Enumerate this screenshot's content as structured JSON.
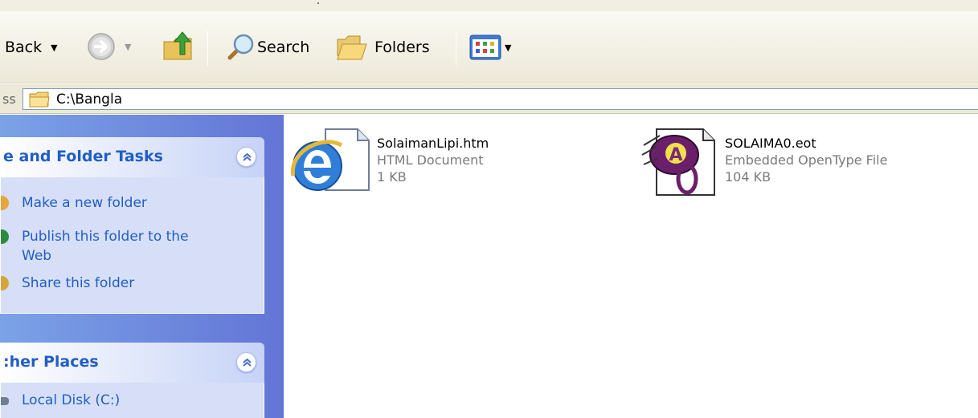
{
  "toolbar": {
    "back_label": "Back",
    "search_label": "Search",
    "folders_label": "Folders"
  },
  "address": {
    "label": "ss",
    "path": "C:\\Bangla"
  },
  "taskpane": {
    "file_tasks": {
      "title": "e and Folder Tasks",
      "items": [
        {
          "label": "Make a new folder",
          "icon": "new-folder-icon"
        },
        {
          "label": "Publish this folder to the",
          "label2": "Web",
          "icon": "globe-icon"
        },
        {
          "label": "Share this folder",
          "icon": "share-icon"
        }
      ]
    },
    "other_places": {
      "title": ":her Places",
      "items": [
        {
          "label": "Local Disk (C:)",
          "icon": "drive-icon"
        }
      ]
    }
  },
  "files": [
    {
      "name": "SolaimanLipi.htm",
      "type": "HTML Document",
      "size": "1 KB",
      "icon": "internet-explorer-icon"
    },
    {
      "name": "SOLAIMA0.eot",
      "type": "Embedded OpenType File",
      "size": "104 KB",
      "icon": "font-file-icon"
    }
  ],
  "colors": {
    "taskpane_gradient_start": "#7ba2e7",
    "taskpane_gradient_end": "#6375d6",
    "task_link": "#215dc6",
    "panel_body": "#d6dff7"
  }
}
